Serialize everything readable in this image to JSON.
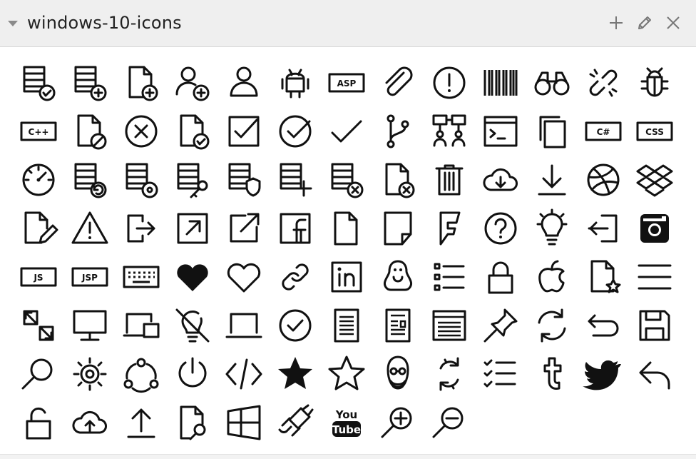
{
  "panel": {
    "title": "windows-10-icons"
  },
  "header_icons": [
    "collapse-triangle-icon",
    "plus-icon",
    "pencil-icon",
    "close-icon"
  ],
  "icons": [
    "database-check",
    "database-add",
    "file-add",
    "user-add",
    "user",
    "android",
    "asp",
    "attach",
    "error",
    "barcode",
    "binoculars",
    "broken-link",
    "bug",
    "cpp",
    "file-blocked",
    "cancel",
    "file-check",
    "checkbox",
    "check-circle",
    "checkmark",
    "branch",
    "org-chart",
    "console",
    "copy",
    "csharp",
    "css",
    "dashboard",
    "database-refresh",
    "database-settings",
    "database-key",
    "database-shield",
    "database-plus",
    "database-remove",
    "file-remove",
    "trash",
    "cloud-download",
    "download",
    "dribbble",
    "dropbox",
    "edit-file",
    "warning",
    "export",
    "open-in-window",
    "external-link",
    "facebook",
    "file",
    "document-fold",
    "foursquare",
    "help",
    "idea",
    "import",
    "instagram",
    "js",
    "jsp",
    "keyboard",
    "heart-filled",
    "heart",
    "link",
    "linkedin",
    "linux",
    "list",
    "lock",
    "apple",
    "file-star",
    "menu",
    "move-by-trackpad",
    "monitor",
    "multiple-devices",
    "no-idea",
    "laptop",
    "ok",
    "document-lines",
    "news",
    "webpage",
    "pin",
    "refresh",
    "undo",
    "save",
    "search",
    "settings",
    "share",
    "power",
    "code",
    "star-filled",
    "star",
    "steve-jobs",
    "sync",
    "task-list",
    "tumblr",
    "twitter",
    "reply",
    "unlock",
    "cloud-upload",
    "upload",
    "file-search",
    "windows",
    "plug",
    "youtube",
    "zoom-in",
    "zoom-out"
  ],
  "colors": {
    "header_bg": "#efefef",
    "icon_stroke": "#111111",
    "grid_bg": "#ffffff"
  }
}
